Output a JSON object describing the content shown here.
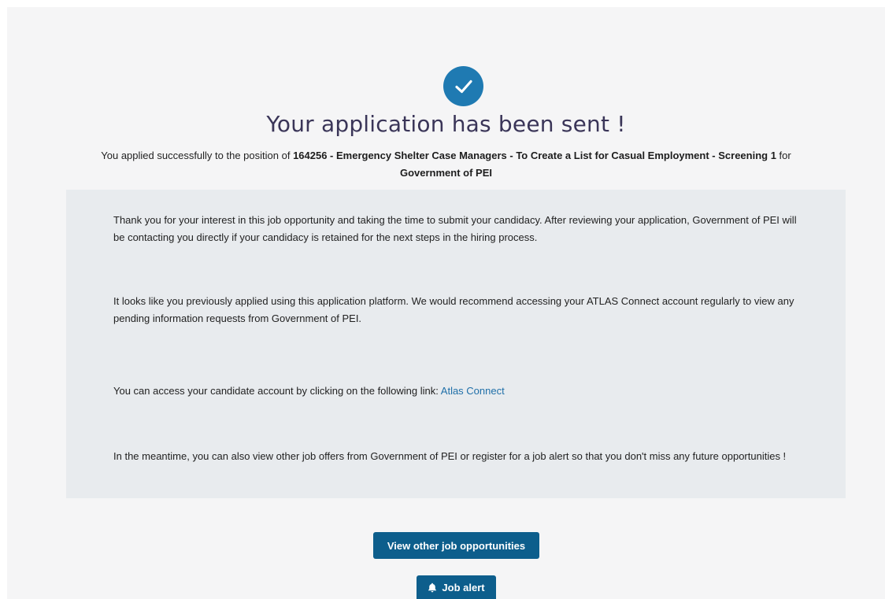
{
  "header": {
    "title": "Your application has been sent !",
    "subtitle_prefix": "You applied successfully to the position of ",
    "position_name": "164256 - Emergency Shelter Case Managers - To Create a List for Casual Employment - Screening 1",
    "subtitle_middle": " for ",
    "employer": "Government of PEI"
  },
  "info": {
    "para1": "Thank you for your interest in this job opportunity and taking the time to submit your candidacy. After reviewing your application, Government of PEI will be contacting you directly if your candidacy is retained for the next steps in the hiring process.",
    "para2": "It looks like you previously applied using this application platform. We would recommend accessing your ATLAS Connect account regularly to view any pending information requests from Government of PEI.",
    "para3_prefix": "You can access your candidate account by clicking on the following link: ",
    "para3_link": "Atlas Connect",
    "para4": "In the meantime, you can also view other job offers from Government of PEI or register for a job alert so that you don't miss any future opportunities !"
  },
  "actions": {
    "view_jobs_label": "View other job opportunities",
    "job_alert_label": "Job alert"
  },
  "icons": {
    "success": "check-circle-icon",
    "alert": "bell-icon"
  },
  "colors": {
    "accent": "#1f7ab2",
    "button": "#0d5e8c",
    "title": "#3a3558",
    "link": "#1f6fa8",
    "panel": "#e8ebee"
  }
}
